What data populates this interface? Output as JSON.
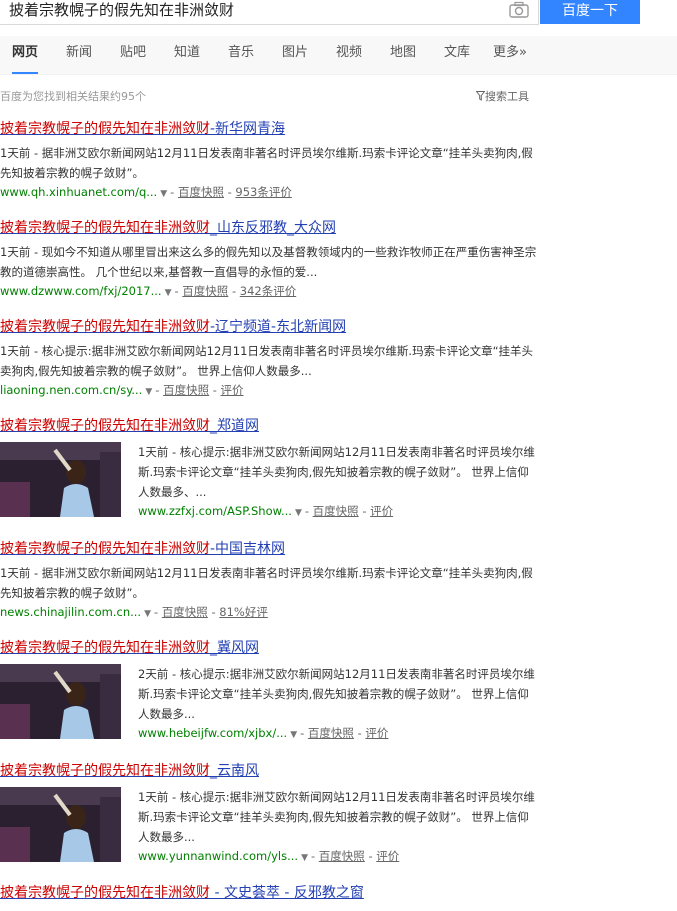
{
  "search": {
    "query": "披着宗教幌子的假先知在非洲敛财",
    "button": "百度一下"
  },
  "tabs": [
    "网页",
    "新闻",
    "贴吧",
    "知道",
    "音乐",
    "图片",
    "视频",
    "地图",
    "文库",
    "更多»"
  ],
  "stats": "百度为您找到相关结果约95个",
  "tools": "搜索工具",
  "results": [
    {
      "title_em": "披着宗教幌子的假先知在非洲敛财",
      "title_rest": "-新华网青海",
      "abstract": "1天前 - 据非洲艾欧尔新闻网站12月11日发表南非著名时评员埃尔维斯.玛索卡评论文章“挂羊头卖狗肉,假先知披着宗教的幌子敛财”。",
      "url": "www.qh.xinhuanet.com/q...",
      "cache": "百度快照",
      "extra": "953条评价"
    },
    {
      "title_em": "披着宗教幌子的假先知在非洲敛财",
      "title_rest": "_山东反邪教_大众网",
      "abstract": "1天前 - 现如今不知道从哪里冒出来这么多的假先知以及基督教领域内的一些救诈牧师正在严重伤害神圣宗教的道德崇高性。 几个世纪以来,基督教一直倡导的永恒的爱...",
      "url": "www.dzwww.com/fxj/2017...",
      "cache": "百度快照",
      "extra": "342条评价"
    },
    {
      "title_em": "披着宗教幌子的假先知在非洲敛财",
      "title_rest": "-辽宁频道-东北新闻网",
      "abstract": "1天前 - 核心提示:据非洲艾欧尔新闻网站12月11日发表南非著名时评员埃尔维斯.玛索卡评论文章“挂羊头卖狗肉,假先知披着宗教的幌子敛财”。 世界上信仰人数最多...",
      "url": "liaoning.nen.com.cn/sy...",
      "cache": "百度快照",
      "extra": "评价"
    },
    {
      "title_em": "披着宗教幌子的假先知在非洲敛财",
      "title_rest": "_郑道网",
      "abstract": "1天前 - 核心提示:据非洲艾欧尔新闻网站12月11日发表南非著名时评员埃尔维斯.玛索卡评论文章“挂羊头卖狗肉,假先知披着宗教的幌子敛财”。 世界上信仰人数最多、...",
      "url": "www.zzfxj.com/ASP.Show...",
      "cache": "百度快照",
      "extra": "评价"
    },
    {
      "title_em": "披着宗教幌子的假先知在非洲敛财",
      "title_rest": "-中国吉林网",
      "abstract": "1天前 - 据非洲艾欧尔新闻网站12月11日发表南非著名时评员埃尔维斯.玛索卡评论文章“挂羊头卖狗肉,假先知披着宗教的幌子敛财”。",
      "url": "news.chinajilin.com.cn...",
      "cache": "百度快照",
      "extra": "81%好评"
    },
    {
      "title_em": "披着宗教幌子的假先知在非洲敛财",
      "title_rest": "_冀风网",
      "abstract": "2天前 - 核心提示:据非洲艾欧尔新闻网站12月11日发表南非著名时评员埃尔维斯.玛索卡评论文章“挂羊头卖狗肉,假先知披着宗教的幌子敛财”。 世界上信仰人数最多...",
      "url": "www.hebeijfw.com/xjbx/...",
      "cache": "百度快照",
      "extra": "评价"
    },
    {
      "title_em": "披着宗教幌子的假先知在非洲敛财",
      "title_rest": "_云南风",
      "abstract": "1天前 - 核心提示:据非洲艾欧尔新闻网站12月11日发表南非著名时评员埃尔维斯.玛索卡评论文章“挂羊头卖狗肉,假先知披着宗教的幌子敛财”。 世界上信仰人数最多...",
      "url": "www.yunnanwind.com/yls...",
      "cache": "百度快照",
      "extra": "评价"
    },
    {
      "title_em": "披着宗教幌子的假先知在非洲敛财",
      "title_rest": " - 文史荟萃 - 反邪教之窗"
    }
  ]
}
